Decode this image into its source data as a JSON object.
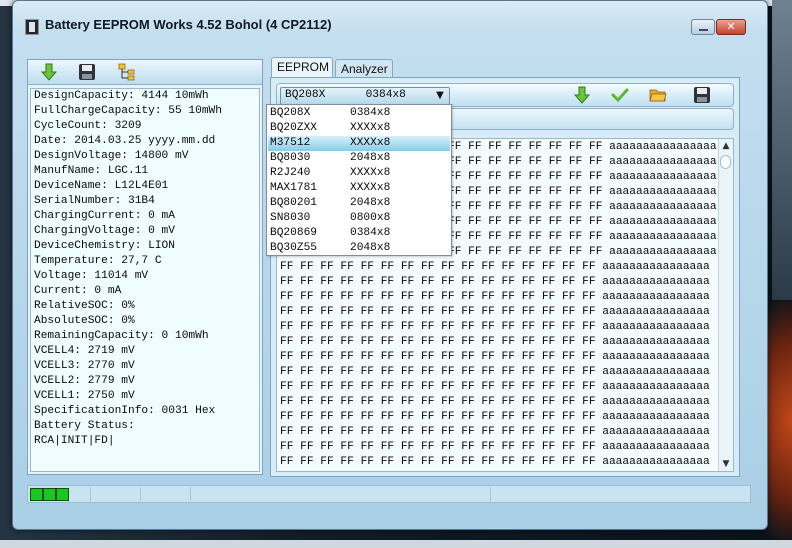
{
  "window": {
    "title": "Battery EEPROM Works  4.52 Bohol (4 CP2112)",
    "close_label": "✕"
  },
  "left_toolbar": {
    "icons": [
      "arrow-down-icon",
      "save-icon",
      "tree-icon"
    ]
  },
  "battery_info": [
    "DesignCapacity: 4144 10mWh",
    "FullChargeCapacity: 55 10mWh",
    "CycleCount: 3209",
    "Date: 2014.03.25 yyyy.mm.dd",
    "DesignVoltage: 14800 mV",
    "ManufName: LGC.11",
    "DeviceName: L12L4E01",
    "SerialNumber: 31B4",
    "ChargingCurrent: 0 mA",
    "ChargingVoltage: 0 mV",
    "DeviceChemistry: LION",
    "Temperature: 27,7 C",
    "Voltage: 11014 mV",
    "Current: 0 mA",
    "RelativeSOC: 0%",
    "AbsoluteSOC: 0%",
    "RemainingCapacity: 0 10mWh",
    "VCELL4: 2719 mV",
    "VCELL3: 2770 mV",
    "VCELL2: 2779 mV",
    "VCELL1: 2750 mV",
    "SpecificationInfo: 0031 Hex",
    "Battery Status:",
    "RCA|INIT|FD|"
  ],
  "tabs": [
    {
      "label": "EEPROM",
      "active": true
    },
    {
      "label": "Analyzer",
      "active": false
    }
  ],
  "chip_select": {
    "name": "BQ208X",
    "size": "0384x8",
    "arrow": "▼"
  },
  "chip_options": [
    {
      "name": "BQ208X",
      "size": "0384x8"
    },
    {
      "name": "BQ20ZXX",
      "size": "XXXXx8"
    },
    {
      "name": "M37512",
      "size": "XXXXx8",
      "highlighted": true
    },
    {
      "name": "BQ8030",
      "size": "2048x8"
    },
    {
      "name": "R2J240",
      "size": "XXXXx8"
    },
    {
      "name": "MAX1781",
      "size": "XXXXx8"
    },
    {
      "name": "BQ80201",
      "size": "2048x8"
    },
    {
      "name": "SN8030",
      "size": "0800x8"
    },
    {
      "name": "BQ20869",
      "size": "0384x8"
    },
    {
      "name": "BQ30Z55",
      "size": "2048x8"
    }
  ],
  "right_toolbar": {
    "icons": [
      "arrow-down-icon",
      "check-icon",
      "folder-open-icon",
      "save-icon"
    ]
  },
  "hex_dump": {
    "partial_rows": [
      "FF FF FF FF FF FF FF FF aaaaaaaaaaaaaaaa",
      "FF FF FF FF FF FF FF FF aaaaaaaaaaaaaaaa",
      "FF FF FF FF FF FF FF FF aaaaaaaaaaaaaaaa",
      "FF FF FF FF FF FF FF FF aaaaaaaaaaaaaaaa",
      "FF FF FF FF FF FF FF FF aaaaaaaaaaaaaaaa",
      "FF FF FF FF FF FF FF FF aaaaaaaaaaaaaaaa",
      "FF FF FF FF FF FF FF FF aaaaaaaaaaaaaaaa",
      "FF FF FF FF FF FF FF FF aaaaaaaaaaaaaaaa"
    ],
    "full_rows": [
      "FF FF FF FF FF FF FF FF FF FF FF FF FF FF FF FF aaaaaaaaaaaaaaaa",
      "FF FF FF FF FF FF FF FF FF FF FF FF FF FF FF FF aaaaaaaaaaaaaaaa",
      "FF FF FF FF FF FF FF FF FF FF FF FF FF FF FF FF aaaaaaaaaaaaaaaa",
      "FF FF FF FF FF FF FF FF FF FF FF FF FF FF FF FF aaaaaaaaaaaaaaaa",
      "FF FF FF FF FF FF FF FF FF FF FF FF FF FF FF FF aaaaaaaaaaaaaaaa",
      "FF FF FF FF FF FF FF FF FF FF FF FF FF FF FF FF aaaaaaaaaaaaaaaa",
      "FF FF FF FF FF FF FF FF FF FF FF FF FF FF FF FF aaaaaaaaaaaaaaaa",
      "FF FF FF FF FF FF FF FF FF FF FF FF FF FF FF FF aaaaaaaaaaaaaaaa",
      "FF FF FF FF FF FF FF FF FF FF FF FF FF FF FF FF aaaaaaaaaaaaaaaa",
      "FF FF FF FF FF FF FF FF FF FF FF FF FF FF FF FF aaaaaaaaaaaaaaaa",
      "FF FF FF FF FF FF FF FF FF FF FF FF FF FF FF FF aaaaaaaaaaaaaaaa",
      "FF FF FF FF FF FF FF FF FF FF FF FF FF FF FF FF aaaaaaaaaaaaaaaa",
      "FF FF FF FF FF FF FF FF FF FF FF FF FF FF FF FF aaaaaaaaaaaaaaaa",
      "FF FF FF FF FF FF FF FF FF FF FF FF FF FF FF FF aaaaaaaaaaaaaaaa"
    ],
    "scroll_up": "▲",
    "scroll_down": "▼"
  },
  "status": {
    "progress_cells_filled": 3,
    "led_color": "#18c81e"
  }
}
